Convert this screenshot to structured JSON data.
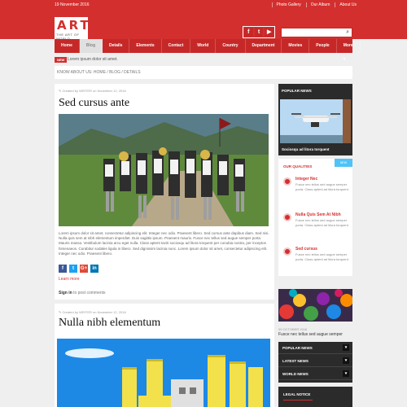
{
  "topbar": {
    "date": "19 November 2016",
    "links": [
      "Photo Gallery",
      "Our Album",
      "About Us"
    ]
  },
  "logo": {
    "name": "ART",
    "tagline": "THE ART OF WORLD"
  },
  "social": {
    "icons": [
      "facebook-icon",
      "twitter-icon",
      "youtube-icon"
    ],
    "glyphs": [
      "f",
      "t",
      "▶"
    ]
  },
  "search": {
    "placeholder": "",
    "icon": "search-icon"
  },
  "nav": {
    "items": [
      "Home",
      "Blog",
      "Details",
      "Elements",
      "Contact",
      "World",
      "Country",
      "Department",
      "Movies",
      "People",
      "More ▾"
    ],
    "active": 1
  },
  "ticker": {
    "badge": "NEW",
    "text": "Lorem ipsum dolor sit amet."
  },
  "breadcrumb": {
    "text": "KNOW ABOUT US: HOME / BLOG / DETAILS"
  },
  "post1": {
    "meta": "✎ Created by WRITER on November 12, 2016",
    "title": "Sed cursus ante",
    "excerpt": "Lorem ipsum dolor sit amet, consectetur adipiscing elit. Integer nec odio. Praesent libero. Sed cursus ante dapibus diam. Sed nisi. Nulla quis sem at nibh elementum imperdiet. Duis sagittis ipsum. Praesent mauris. Fusce nec tellus sed augue semper porta. Mauris massa. Vestibulum lacinia arcu eget nulla. Class aptent taciti sociosqu ad litora torquent per conubia nostra, per inceptos himenaeos. Curabitur sodales ligula in libero. Sed dignissim lacinia nunc. Lorem ipsum dolor sit amet, consectetur adipiscing elit. Integer nec odio. Praesent libero.",
    "share": [
      "f",
      "t",
      "G+",
      "in"
    ],
    "learn_more": "Learn more"
  },
  "signin": {
    "link": "Sign in",
    "rest": " to post comments"
  },
  "post2": {
    "meta": "✎ Created by WRITER on November 12, 2016",
    "title": "Nulla nibh elementum"
  },
  "popular": {
    "heading": "POPULAR NEWS",
    "caption": "Sociosqu ad litora torquent"
  },
  "qualities": {
    "heading": "OUR QUALITIES",
    "corner": "NEW",
    "items": [
      {
        "title": "Integer Nec",
        "desc": "Fusce nec tellus sed augue semper porta. Class aptent ad litora torquent."
      },
      {
        "title": "Nulla Quis Sem At Nibh",
        "desc": "Fusce nec tellus sed augue semper porta. Class aptent ad litora torquent."
      },
      {
        "title": "Sed cursus",
        "desc": "Fusce nec tellus sed augue semper porta. Class aptent ad litora torquent."
      }
    ]
  },
  "balls": {
    "date": "09 OCTOBER 2016",
    "caption": "Fusce nec tellus sed augue semper"
  },
  "tabs": {
    "items": [
      "POPULAR NEWS",
      "LATEST NEWS",
      "WORLD NEWS"
    ],
    "arrow": "▾"
  },
  "legal": {
    "heading": "LEGAL NOTICE"
  }
}
